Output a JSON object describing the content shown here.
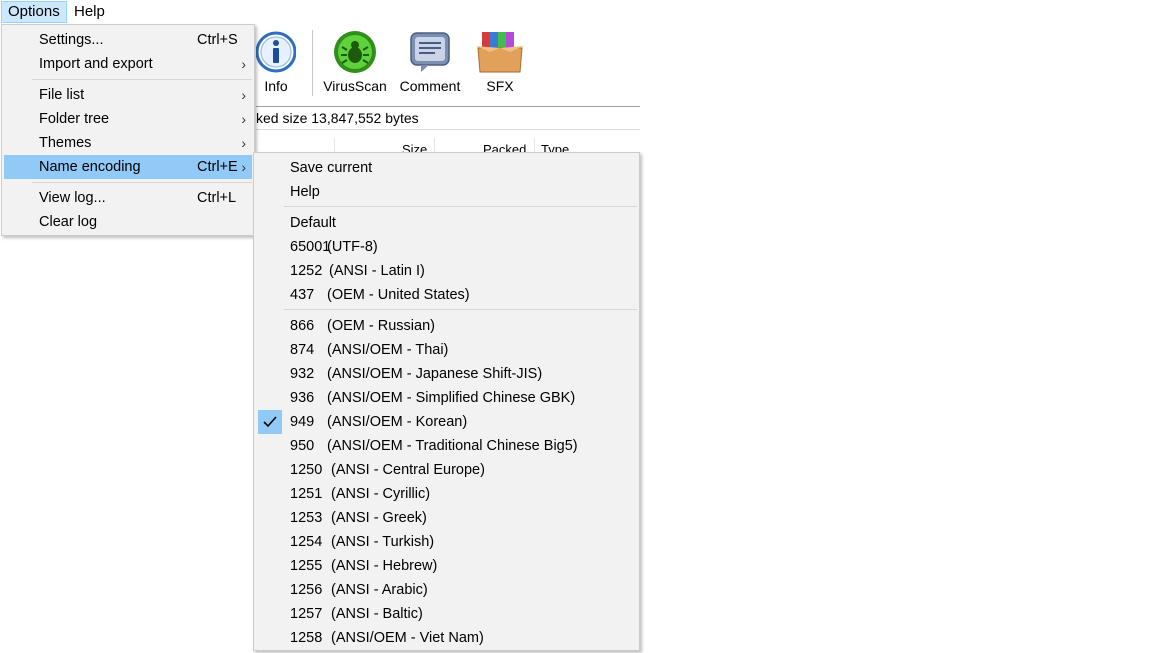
{
  "menubar": {
    "options": "Options",
    "help": "Help"
  },
  "toolbar": {
    "info": "Info",
    "virusscan": "VirusScan",
    "comment": "Comment",
    "sfx": "SFX"
  },
  "status": {
    "text": "ked size 13,847,552 bytes"
  },
  "columns": {
    "size": "Size",
    "packed": "Packed",
    "type": "Type"
  },
  "options_menu": {
    "items": [
      {
        "label": "Settings...",
        "shortcut": "Ctrl+S"
      },
      {
        "label": "Import and export",
        "arrow": "›"
      },
      {
        "label": "File list",
        "arrow": "›"
      },
      {
        "label": "Folder tree",
        "arrow": "›"
      },
      {
        "label": "Themes",
        "arrow": "›"
      },
      {
        "label": "Name encoding",
        "shortcut": "Ctrl+E",
        "arrow": "›"
      },
      {
        "label": "View log...",
        "shortcut": "Ctrl+L"
      },
      {
        "label": "Clear log"
      }
    ]
  },
  "encoding_menu": {
    "save_current": "Save current",
    "help": "Help",
    "default": "Default",
    "items": [
      {
        "code": "65001",
        "desc": "(UTF-8)"
      },
      {
        "code": "1252",
        "desc": "(ANSI - Latin I)"
      },
      {
        "code": "437",
        "desc": "(OEM - United States)"
      },
      {
        "code": "866",
        "desc": "(OEM - Russian)"
      },
      {
        "code": "874",
        "desc": "(ANSI/OEM - Thai)"
      },
      {
        "code": "932",
        "desc": "(ANSI/OEM - Japanese Shift-JIS)"
      },
      {
        "code": "936",
        "desc": "(ANSI/OEM - Simplified Chinese GBK)"
      },
      {
        "code": "949",
        "desc": "(ANSI/OEM - Korean)",
        "checked": true
      },
      {
        "code": "950",
        "desc": "(ANSI/OEM - Traditional Chinese Big5)"
      },
      {
        "code": "1250",
        "desc": "(ANSI - Central Europe)"
      },
      {
        "code": "1251",
        "desc": "(ANSI - Cyrillic)"
      },
      {
        "code": "1253",
        "desc": "(ANSI - Greek)"
      },
      {
        "code": "1254",
        "desc": "(ANSI - Turkish)"
      },
      {
        "code": "1255",
        "desc": "(ANSI - Hebrew)"
      },
      {
        "code": "1256",
        "desc": "(ANSI - Arabic)"
      },
      {
        "code": "1257",
        "desc": "(ANSI - Baltic)"
      },
      {
        "code": "1258",
        "desc": "(ANSI/OEM - Viet Nam)"
      }
    ]
  },
  "colors": {
    "highlight": "#91c9f7",
    "menu_bg": "#f2f2f2",
    "menubar_active": "#cce8ff"
  }
}
